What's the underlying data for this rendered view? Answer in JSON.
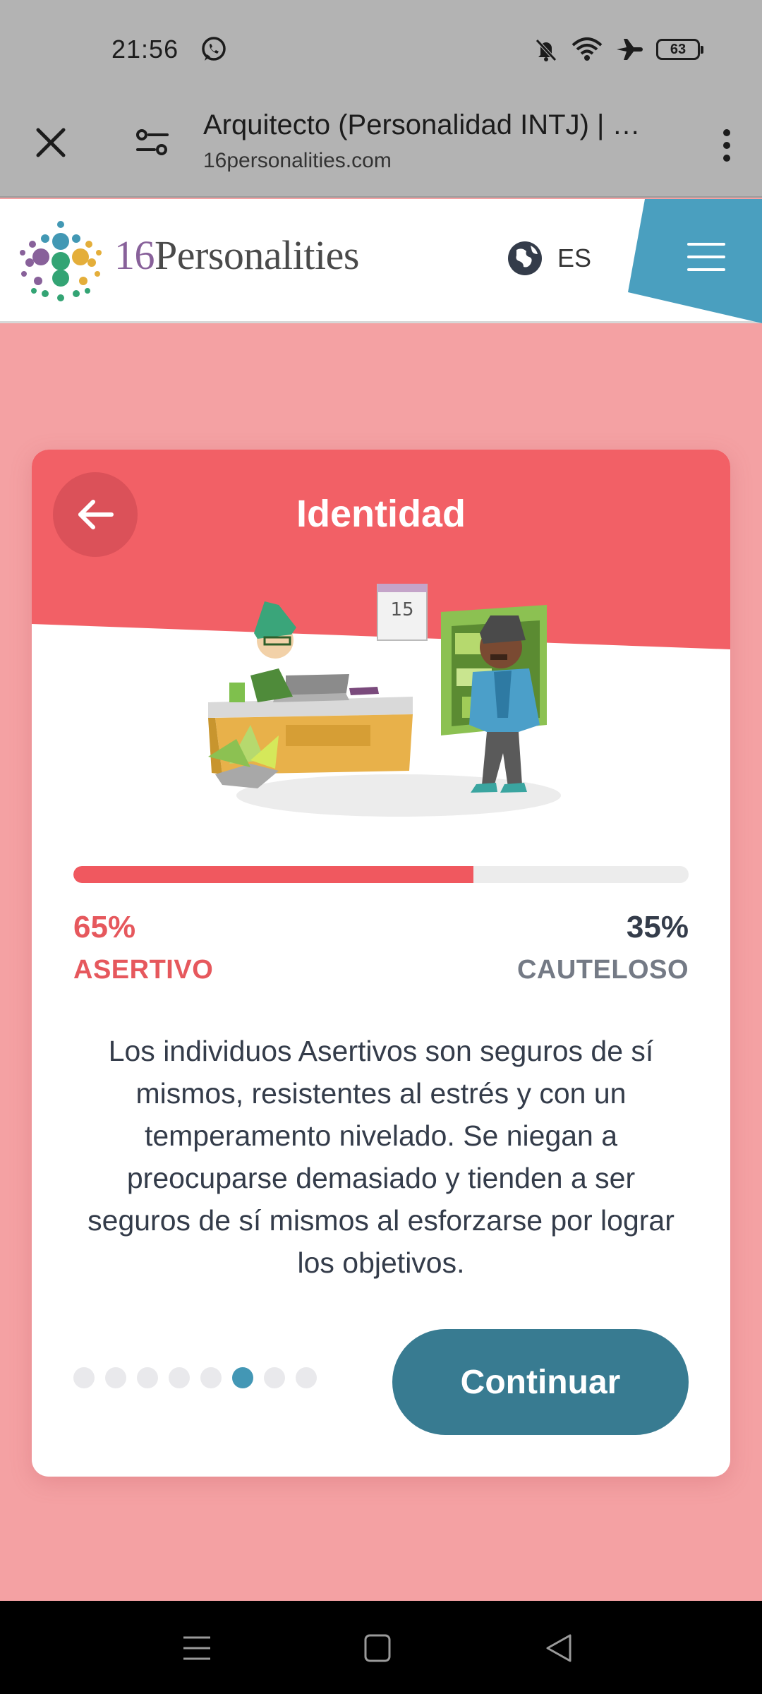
{
  "status_bar": {
    "time": "21:56",
    "battery": "63",
    "icons": [
      "whatsapp-icon",
      "bell-off-icon",
      "wifi-icon",
      "airplane-icon",
      "battery-icon"
    ]
  },
  "browser": {
    "page_title": "Arquitecto (Personalidad INTJ) | …",
    "domain": "16personalities.com"
  },
  "site": {
    "logo_number": "16",
    "logo_word": "Personalities",
    "language": "ES",
    "accent": "#4a9fbf"
  },
  "card": {
    "title": "Identidad",
    "progress": 0.65,
    "left": {
      "percent": "65%",
      "label": "ASERTIVO"
    },
    "right": {
      "percent": "35%",
      "label": "CAUTELOSO"
    },
    "description": "Los individuos Asertivos son seguros de sí mismos, resistentes al estrés y con un temperamento nivelado. Se niegan a preocuparse demasiado y tienden a ser seguros de sí mismos al esforzarse por lograr los objetivos.",
    "illustration_calendar": "15",
    "pagination": {
      "total": 8,
      "active_index": 5
    },
    "continue_label": "Continuar"
  },
  "colors": {
    "page_bg": "#f4a1a3",
    "card_header": "#f26066",
    "assertive": "#e6585d",
    "cautious": "#747a85",
    "button": "#387b91",
    "active_dot": "#4397b5"
  }
}
